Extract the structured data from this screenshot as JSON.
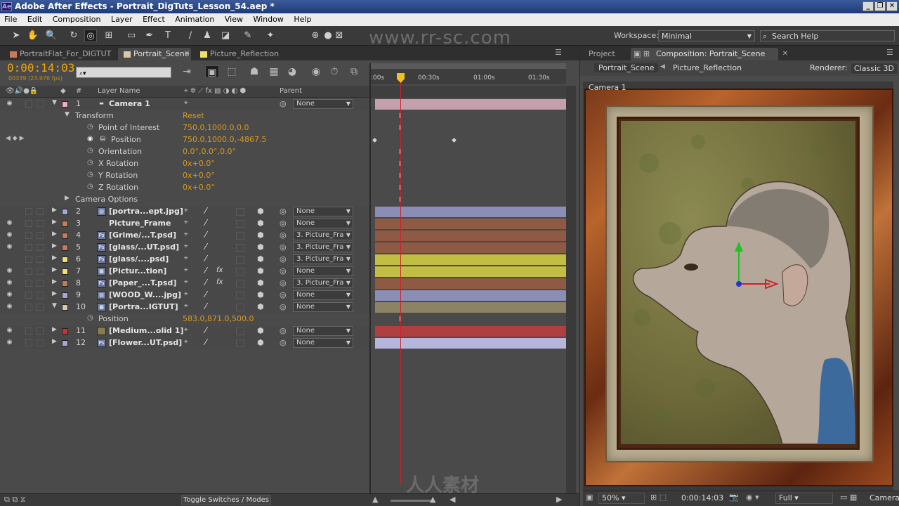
{
  "window": {
    "title": "Adobe After Effects - Portrait_DigTuts_Lesson_54.aep *",
    "app_icon": "Ae"
  },
  "menu": [
    "File",
    "Edit",
    "Composition",
    "Layer",
    "Effect",
    "Animation",
    "View",
    "Window",
    "Help"
  ],
  "toolbar": {
    "workspace_label": "Workspace:",
    "workspace_value": "Minimal",
    "search_placeholder": "Search Help"
  },
  "watermark": "www.rr-sc.com",
  "timeline": {
    "tabs": [
      "PortraitFlat_For_DIGTUT",
      "Portrait_Scene",
      "Picture_Reflection"
    ],
    "active_tab": 1,
    "timecode": "0:00:14:03",
    "fps": "00339 (23.976 fps)",
    "search_placeholder": "",
    "ruler_labels": [
      ":00s",
      "00:30s",
      "01:00s",
      "01:30s"
    ],
    "columns": {
      "num": "#",
      "layer_name": "Layer Name",
      "parent": "Parent"
    },
    "toggle_label": "Toggle Switches / Modes"
  },
  "layers": [
    {
      "num": "1",
      "name": "Camera 1",
      "parent": "None",
      "color": "#e8b0c0",
      "bar": "#c4a0ad",
      "icon": "camera"
    },
    {
      "num": "2",
      "name": "[portra...ept.jpg]",
      "parent": "None",
      "color": "#a8a8d8",
      "bar": "#8a8eb4",
      "icon": "footage"
    },
    {
      "num": "3",
      "name": "Picture_Frame",
      "parent": "None",
      "color": "#c87a5a",
      "bar": "#8e5a44",
      "icon": ""
    },
    {
      "num": "4",
      "name": "[Grime/...T.psd]",
      "parent": "3. Picture_Fra",
      "color": "#c87a5a",
      "bar": "#8e5a44",
      "icon": "psd"
    },
    {
      "num": "5",
      "name": "[glass/...UT.psd]",
      "parent": "3. Picture_Fra",
      "color": "#c87a5a",
      "bar": "#8e5a44",
      "icon": "psd"
    },
    {
      "num": "6",
      "name": "[glass/....psd]",
      "parent": "3. Picture_Fra",
      "color": "#f0e070",
      "bar": "#c2be44",
      "icon": "psd"
    },
    {
      "num": "7",
      "name": "[Pictur...tion]",
      "parent": "None",
      "color": "#f0e070",
      "bar": "#c2be44",
      "icon": "comp"
    },
    {
      "num": "8",
      "name": "[Paper_...T.psd]",
      "parent": "3. Picture_Fra",
      "color": "#c87a5a",
      "bar": "#8e5a44",
      "icon": "psd"
    },
    {
      "num": "9",
      "name": "[WOOD_W....jpg]",
      "parent": "None",
      "color": "#a8a8d8",
      "bar": "#8a8eb4",
      "icon": "footage"
    },
    {
      "num": "10",
      "name": "[Portra...IGTUT]",
      "parent": "None",
      "color": "#d8c8a8",
      "bar": "#8c8266",
      "icon": "comp"
    },
    {
      "num": "11",
      "name": "[Medium...olid 1]",
      "parent": "None",
      "color": "#d03030",
      "bar": "#b04040",
      "icon": "solid"
    },
    {
      "num": "12",
      "name": "[Flower...UT.psd]",
      "parent": "None",
      "color": "#a8a8d8",
      "bar": "#b6b6dc",
      "icon": "psd"
    }
  ],
  "transform": {
    "label": "Transform",
    "reset": "Reset",
    "props": [
      {
        "name": "Point of Interest",
        "value": "750.0,1000.0,0.0"
      },
      {
        "name": "Position",
        "value": "750.0,1000.0,-4867.5"
      },
      {
        "name": "Orientation",
        "value": "0.0°,0.0°,0.0°"
      },
      {
        "name": "X Rotation",
        "value": "0x+0.0°"
      },
      {
        "name": "Y Rotation",
        "value": "0x+0.0°"
      },
      {
        "name": "Z Rotation",
        "value": "0x+0.0°"
      }
    ],
    "camera_options": "Camera Options"
  },
  "layer10_position": {
    "name": "Position",
    "value": "583.0,871.0,500.0"
  },
  "comp_panel": {
    "tabs": [
      "Project",
      "Composition: Portrait_Scene"
    ],
    "breadcrumb": [
      "Portrait_Scene",
      "Picture_Reflection"
    ],
    "renderer_label": "Renderer:",
    "renderer_value": "Classic 3D",
    "camera_label": "Camera 1",
    "zoom": "50%",
    "timecode": "0:00:14:03",
    "resolution": "Full",
    "view": "Camera"
  },
  "brand_watermark": "人人素材"
}
